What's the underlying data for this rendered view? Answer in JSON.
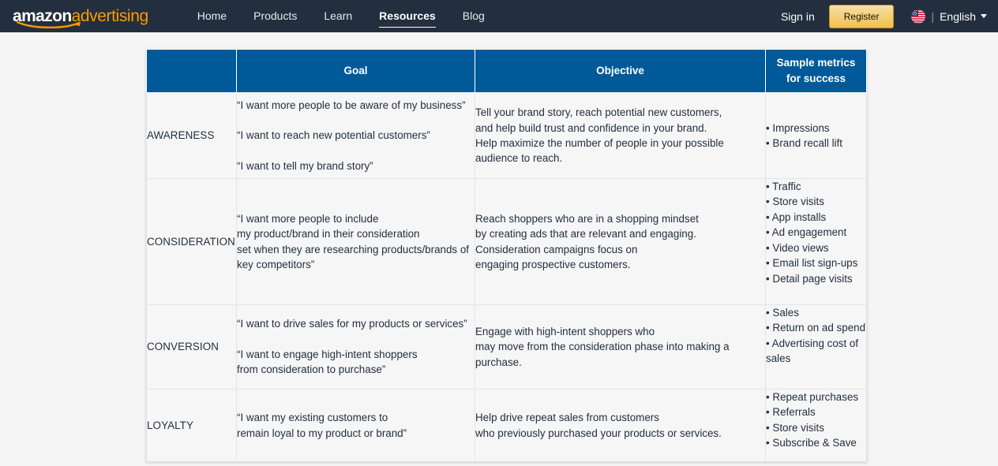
{
  "navbar": {
    "brand": {
      "part1": "amazon",
      "part2": "advertising"
    },
    "links": [
      {
        "label": "Home",
        "active": false
      },
      {
        "label": "Products",
        "active": false
      },
      {
        "label": "Learn",
        "active": false
      },
      {
        "label": "Resources",
        "active": true
      },
      {
        "label": "Blog",
        "active": false
      }
    ],
    "sign_in_label": "Sign in",
    "register_label": "Register",
    "divider": "|",
    "language_label": "English",
    "flag_icon": "us-flag-icon",
    "chevron_icon": "chevron-down-icon",
    "colors": {
      "background": "#232f3e",
      "brand_accent": "#ff9900",
      "register_button": "#f0c14b"
    }
  },
  "table": {
    "header_color": "#005a99",
    "columns": [
      {
        "label": ""
      },
      {
        "label": "Goal"
      },
      {
        "label": "Objective"
      },
      {
        "label": "Sample metrics for success"
      }
    ],
    "rows": [
      {
        "stage": "AWARENESS",
        "goals": [
          "“I want more people to be aware of my business”",
          "“I want to reach new potential customers”",
          "“I want to tell my brand story”"
        ],
        "objective": [
          "Tell your brand story, reach potential new customers,",
          "and help build trust and confidence in your brand.",
          "Help maximize the number of people in your possible",
          "audience to reach."
        ],
        "metrics": [
          "• Impressions",
          "• Brand recall lift"
        ]
      },
      {
        "stage": "CONSIDERATION",
        "goals": [
          "“I want more people to include\nmy product/brand in their consideration\nset when they are researching products/brands of\nkey competitors”"
        ],
        "objective": [
          "Reach shoppers who are in a shopping mindset",
          "by creating ads that are relevant and engaging.",
          "Consideration campaigns focus on",
          "engaging prospective customers."
        ],
        "metrics": [
          "• Traffic",
          "• Store visits",
          "• App installs",
          "• Ad engagement",
          "• Video views",
          "• Email list sign-ups",
          "• Detail page visits"
        ]
      },
      {
        "stage": "CONVERSION",
        "goals": [
          "“I want to drive sales for my products or services”",
          "“I want to engage high-intent shoppers\nfrom consideration to purchase”"
        ],
        "objective": [
          "Engage with high-intent shoppers who",
          "may move from the consideration phase into making a",
          "purchase."
        ],
        "metrics": [
          "• Sales",
          "• Return on ad spend",
          "• Advertising cost of sales"
        ]
      },
      {
        "stage": "LOYALTY",
        "goals": [
          "“I want my existing customers to\nremain loyal to my product or brand”"
        ],
        "objective": [
          "Help drive repeat sales from customers",
          "who previously purchased your products or services."
        ],
        "metrics": [
          "• Repeat purchases",
          "• Referrals",
          "• Store visits",
          "• Subscribe & Save"
        ]
      }
    ]
  }
}
